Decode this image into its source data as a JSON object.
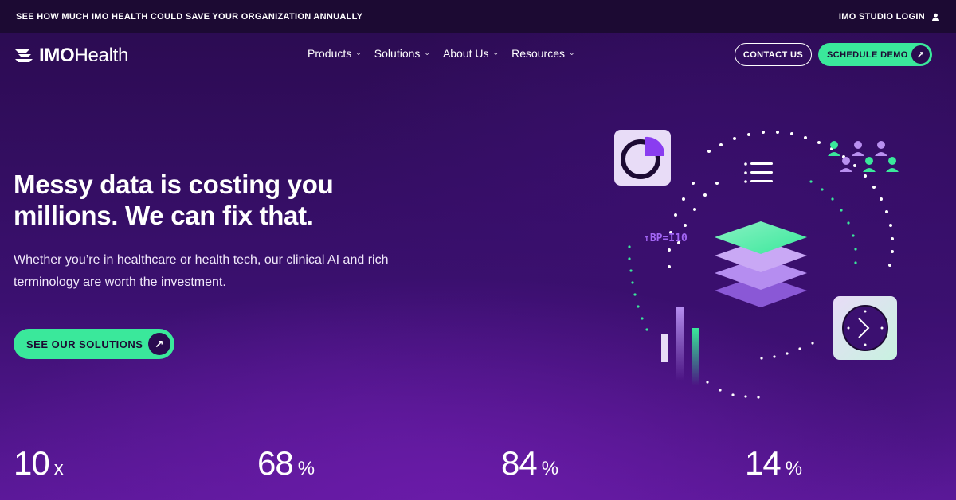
{
  "topbar": {
    "promo": "SEE HOW MUCH IMO HEALTH COULD SAVE YOUR ORGANIZATION ANNUALLY",
    "login": "IMO STUDIO LOGIN"
  },
  "logo": {
    "imo": "IMO",
    "health": "Health"
  },
  "nav": {
    "items": [
      {
        "label": "Products"
      },
      {
        "label": "Solutions"
      },
      {
        "label": "About Us"
      },
      {
        "label": "Resources"
      }
    ],
    "contact": "CONTACT US",
    "demo": "SCHEDULE DEMO"
  },
  "hero": {
    "title": "Messy data is costing you millions. We can fix that.",
    "subtitle": "Whether you’re in healthcare or health tech, our clinical AI and rich terminology are worth the investment.",
    "cta": "SEE OUR SOLUTIONS"
  },
  "illustration": {
    "bp_label": "↑BP=I10"
  },
  "stats": [
    {
      "value": "10",
      "unit": "x"
    },
    {
      "value": "68",
      "unit": "%"
    },
    {
      "value": "84",
      "unit": "%"
    },
    {
      "value": "14",
      "unit": "%"
    }
  ],
  "colors": {
    "accent": "#3ae89b",
    "topbar": "#1c0a33",
    "bg": "#3b1070",
    "purple_icon": "#8a3df0"
  }
}
